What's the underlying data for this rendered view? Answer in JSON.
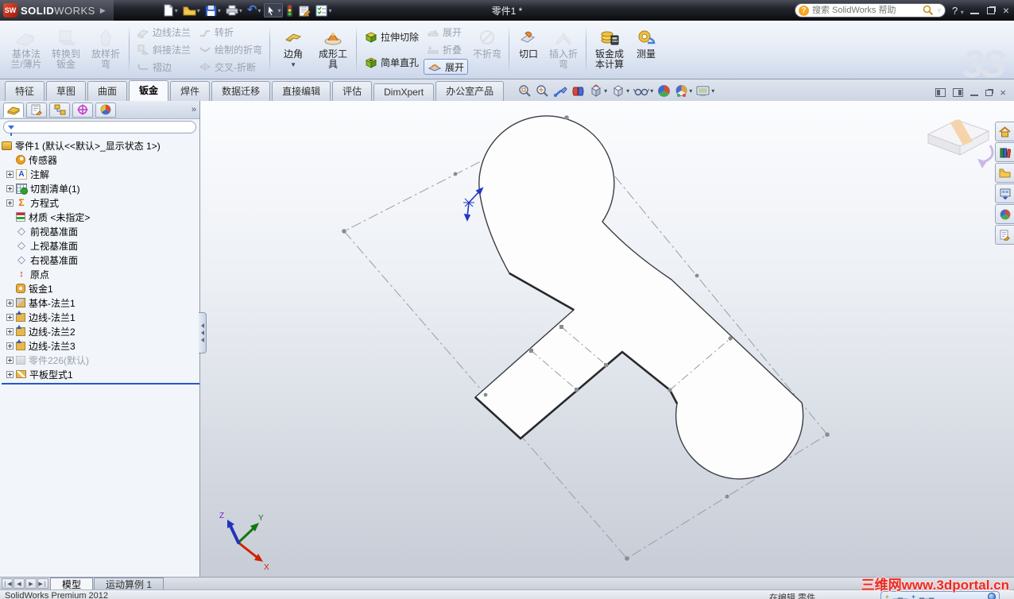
{
  "titlebar": {
    "brand_cube": "SW",
    "brand_bold": "SOLID",
    "brand_light": "WORKS",
    "doc_title": "零件1 *",
    "search_placeholder": "搜索 SolidWorks 帮助",
    "toolbar_icon_names": [
      "new-document",
      "open",
      "save",
      "print",
      "undo",
      "select-cursor",
      "rebuild-traffic-light",
      "options-note",
      "checklist"
    ]
  },
  "ribbon": {
    "base_flange": {
      "l1": "基体法",
      "l2": "兰/薄片"
    },
    "convert_to_sheetmetal": {
      "l1": "转换到",
      "l2": "钣金"
    },
    "lofted_bend": {
      "l1": "放样折",
      "l2": "弯"
    },
    "edge_flange": "边线法兰",
    "miter_flange": "斜接法兰",
    "hem": "褶边",
    "jog": "转折",
    "sketched_bend": "绘制的折弯",
    "cross_break": "交叉-折断",
    "corner": "边角",
    "forming_tool": {
      "l1": "成形工",
      "l2": "具"
    },
    "extruded_cut": "拉伸切除",
    "simple_hole": "简单直孔",
    "unfold": "展开",
    "fold": "折叠",
    "flatten": "展开",
    "no_bends": "不折弯",
    "rip": "切口",
    "insert_bends": {
      "l1": "插入折",
      "l2": "弯"
    },
    "cost": {
      "l1": "钣金成",
      "l2": "本计算"
    },
    "measure": "测量",
    "ds_watermark": "3S"
  },
  "command_tabs": [
    {
      "label": "特征"
    },
    {
      "label": "草图"
    },
    {
      "label": "曲面"
    },
    {
      "label": "钣金",
      "active": true
    },
    {
      "label": "焊件"
    },
    {
      "label": "数据迁移"
    },
    {
      "label": "直接编辑"
    },
    {
      "label": "评估"
    },
    {
      "label": "DimXpert"
    },
    {
      "label": "办公室产品"
    }
  ],
  "hud_icon_names": [
    "zoom-fit",
    "zoom-to-area",
    "magnified-selection",
    "section-view",
    "view-orientation",
    "display-style",
    "hide-show-items",
    "edit-appearance",
    "apply-scene",
    "view-settings"
  ],
  "sidebar": {
    "manager_tab_names": [
      "feature-manager",
      "property-manager",
      "configuration-manager",
      "dimxpert-manager",
      "display-manager"
    ],
    "overflow_chevron": "»",
    "root_label": "零件1 (默认<<默认>_显示状态 1>)",
    "tree": [
      {
        "icon": "sensor",
        "label": "传感器"
      },
      {
        "icon": "annotations",
        "label": "注解",
        "plus": true
      },
      {
        "icon": "cutlist",
        "label": "切割清单(1)",
        "plus": true
      },
      {
        "icon": "equations",
        "label": "方程式",
        "plus": true
      },
      {
        "icon": "material",
        "label": "材质 <未指定>"
      },
      {
        "icon": "plane",
        "label": "前视基准面"
      },
      {
        "icon": "plane",
        "label": "上视基准面"
      },
      {
        "icon": "plane",
        "label": "右视基准面"
      },
      {
        "icon": "origin",
        "label": "原点"
      },
      {
        "icon": "sheetmetal",
        "label": "钣金1"
      },
      {
        "icon": "base-flange",
        "label": "基体-法兰1",
        "plus": true
      },
      {
        "icon": "edge-flange",
        "label": "边线-法兰1",
        "plus": true
      },
      {
        "icon": "edge-flange",
        "label": "边线-法兰2",
        "plus": true
      },
      {
        "icon": "edge-flange",
        "label": "边线-法兰3",
        "plus": true
      },
      {
        "icon": "derived-part",
        "label": "零件226(默认)",
        "plus": true,
        "grayed": true
      },
      {
        "icon": "flat-pattern",
        "label": "平板型式1",
        "plus": true
      }
    ]
  },
  "viewport": {
    "triad": {
      "x": "X",
      "y": "Y",
      "z": "Z"
    },
    "taskpane_icon_names": [
      "home",
      "design-library",
      "file-explorer",
      "view-palette",
      "appearances",
      "custom-properties"
    ]
  },
  "bottombar": {
    "tabs": [
      {
        "label": "模型",
        "active": true
      },
      {
        "label": "运动算例 1"
      }
    ]
  },
  "statusbar": {
    "left": "SolidWorks Premium 2012",
    "editing": "在编辑 零件"
  },
  "watermark": "三维网www.3dportal.cn"
}
